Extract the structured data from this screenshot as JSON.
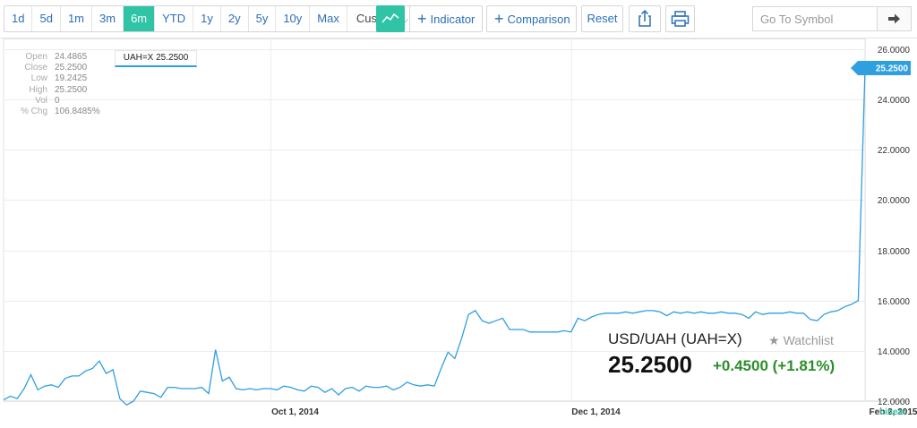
{
  "toolbar": {
    "ranges": [
      "1d",
      "5d",
      "1m",
      "3m",
      "6m",
      "YTD",
      "1y",
      "2y",
      "5y",
      "10y",
      "Max"
    ],
    "active_range": "6m",
    "custom_label": "Custom",
    "chart_type_icon": "line-chart-icon",
    "indicator_label": "Indicator",
    "comparison_label": "Comparison",
    "reset_label": "Reset",
    "share_icon": "share-icon",
    "print_icon": "print-icon",
    "symbol_placeholder": "Go To Symbol",
    "go_icon": "arrow-right-icon",
    "accent_color": "#2ec4a5",
    "link_color": "#2b6fb8"
  },
  "ohlc": {
    "rows": [
      {
        "key": "Open",
        "value": "24.4865"
      },
      {
        "key": "Close",
        "value": "25.2500"
      },
      {
        "key": "Low",
        "value": "19.2425"
      },
      {
        "key": "High",
        "value": "25.2500"
      },
      {
        "key": "Vol",
        "value": "0"
      },
      {
        "key": "% Chg",
        "value": "106.8485%"
      }
    ]
  },
  "legend_tag": "UAH=X 25.2500",
  "quote": {
    "name": "USD/UAH (UAH=X)",
    "watchlist_label": "Watchlist",
    "price": "25.2500",
    "change": "+0.4500 (+1.81%)",
    "change_color": "#2a8f2a"
  },
  "chart_data": {
    "type": "line",
    "series": [
      {
        "name": "UAH=X",
        "color": "#2f9fe0",
        "values": [
          12.05,
          12.2,
          12.1,
          12.5,
          13.05,
          12.45,
          12.6,
          12.65,
          12.55,
          12.9,
          13.0,
          13.0,
          13.2,
          13.3,
          13.6,
          13.1,
          13.25,
          12.1,
          11.85,
          12.0,
          12.4,
          12.35,
          12.3,
          12.15,
          12.55,
          12.55,
          12.5,
          12.5,
          12.5,
          12.55,
          12.3,
          14.05,
          12.8,
          12.95,
          12.5,
          12.45,
          12.5,
          12.45,
          12.5,
          12.5,
          12.45,
          12.6,
          12.55,
          12.45,
          12.4,
          12.6,
          12.55,
          12.35,
          12.5,
          12.25,
          12.5,
          12.55,
          12.4,
          12.6,
          12.55,
          12.55,
          12.6,
          12.45,
          12.55,
          12.75,
          12.65,
          12.6,
          12.65,
          12.6,
          13.3,
          13.95,
          13.7,
          14.5,
          15.45,
          15.6,
          15.2,
          15.1,
          15.2,
          15.3,
          14.85,
          14.85,
          14.85,
          14.75,
          14.75,
          14.75,
          14.75,
          14.75,
          14.8,
          14.75,
          15.3,
          15.2,
          15.35,
          15.45,
          15.5,
          15.5,
          15.5,
          15.55,
          15.5,
          15.55,
          15.6,
          15.6,
          15.55,
          15.4,
          15.55,
          15.5,
          15.55,
          15.5,
          15.55,
          15.5,
          15.5,
          15.55,
          15.5,
          15.5,
          15.45,
          15.3,
          15.55,
          15.45,
          15.5,
          15.5,
          15.5,
          15.55,
          15.5,
          15.5,
          15.25,
          15.2,
          15.45,
          15.55,
          15.6,
          15.75,
          15.85,
          16.0,
          25.25
        ]
      }
    ],
    "ylim": [
      12.0,
      26.0
    ],
    "y_ticks": [
      "12.0000",
      "14.0000",
      "16.0000",
      "18.0000",
      "20.0000",
      "22.0000",
      "24.0000",
      "26.0000"
    ],
    "x_ticks": [
      "Oct 1, 2014",
      "Dec 1, 2014",
      "Feb 2, 2015"
    ],
    "x_tick_index": [
      39,
      83,
      126
    ],
    "last_value": "25.2500",
    "scale_label": "Linear",
    "grid": true
  }
}
